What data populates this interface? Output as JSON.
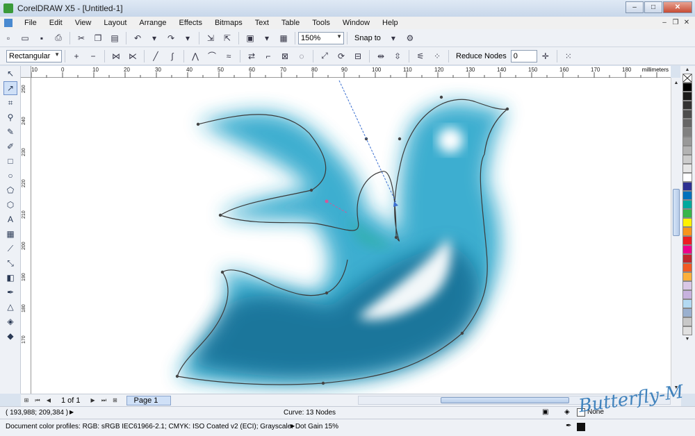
{
  "window": {
    "title": "CorelDRAW X5 - [Untitled-1]"
  },
  "menu": [
    "File",
    "Edit",
    "View",
    "Layout",
    "Arrange",
    "Effects",
    "Bitmaps",
    "Text",
    "Table",
    "Tools",
    "Window",
    "Help"
  ],
  "toolbar": {
    "zoom": "150%",
    "snap_to": "Snap to"
  },
  "property_bar": {
    "selection_mode": "Rectangular",
    "reduce_nodes_label": "Reduce Nodes",
    "reduce_nodes_value": "0"
  },
  "ruler": {
    "unit": "millimeters",
    "h_ticks": [
      "10",
      "0",
      "10",
      "20",
      "30",
      "40",
      "50",
      "60",
      "70",
      "80",
      "90",
      "100",
      "110",
      "120",
      "130",
      "140",
      "150",
      "160",
      "170",
      "180"
    ],
    "v_ticks": [
      "250",
      "240",
      "230",
      "220",
      "210",
      "200",
      "190",
      "180",
      "170"
    ]
  },
  "page_nav": {
    "count": "1 of 1",
    "page_tab": "Page 1"
  },
  "status": {
    "coords": "( 193,988; 209,384 )",
    "selection": "Curve: 13 Nodes",
    "profiles": "Document color profiles: RGB: sRGB IEC61966-2.1; CMYK: ISO Coated v2 (ECI); Grayscale: Dot Gain 15%",
    "fill": "None"
  },
  "palette": [
    "#000000",
    "#1a1a1a",
    "#333333",
    "#4d4d4d",
    "#666666",
    "#808080",
    "#999999",
    "#b3b3b3",
    "#cccccc",
    "#e6e6e6",
    "#ffffff",
    "#2e3192",
    "#0071bc",
    "#00a99d",
    "#39b54a",
    "#fff200",
    "#f7941d",
    "#ed1c24",
    "#ec008c",
    "#c1272d",
    "#f15a24",
    "#fbb03b",
    "#d9c7e6",
    "#c7b2de",
    "#b3d9f2",
    "#9ab0cf",
    "#c8c8c8",
    "#e0e0e0"
  ],
  "brand": {
    "image_fill": "#1fa0c8",
    "image_dark": "#0c5f86",
    "watermark_color": "#2f78b8"
  },
  "watermark": "Butterfly-M"
}
